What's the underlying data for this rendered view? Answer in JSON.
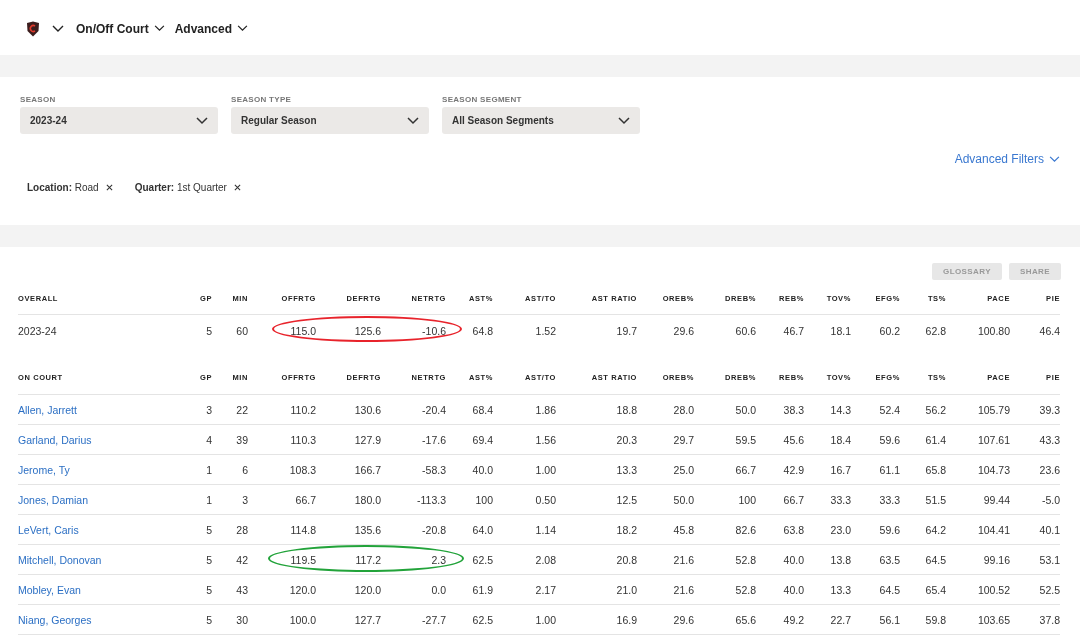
{
  "nav": {
    "menus": [
      {
        "label": "On/Off Court"
      },
      {
        "label": "Advanced"
      }
    ]
  },
  "filters": {
    "selects": [
      {
        "label": "SEASON",
        "value": "2023-24"
      },
      {
        "label": "SEASON TYPE",
        "value": "Regular Season"
      },
      {
        "label": "SEASON SEGMENT",
        "value": "All Season Segments"
      }
    ],
    "advanced_filters": "Advanced Filters",
    "chips": [
      {
        "name": "Location:",
        "value": "Road"
      },
      {
        "name": "Quarter:",
        "value": "1st Quarter"
      }
    ]
  },
  "toolbar": {
    "buttons": [
      "GLOSSARY",
      "SHARE"
    ]
  },
  "overall": {
    "columns": [
      "OVERALL",
      "GP",
      "MIN",
      "OFFRTG",
      "DEFRTG",
      "NETRTG",
      "AST%",
      "AST/TO",
      "AST RATIO",
      "OREB%",
      "DREB%",
      "REB%",
      "TOV%",
      "EFG%",
      "TS%",
      "PACE",
      "PIE"
    ],
    "row": {
      "cells": [
        "2023-24",
        "5",
        "60",
        "115.0",
        "125.6",
        "-10.6",
        "64.8",
        "1.52",
        "19.7",
        "29.6",
        "60.6",
        "46.7",
        "18.1",
        "60.2",
        "62.8",
        "100.80",
        "46.4"
      ],
      "circled": true
    }
  },
  "on_court": {
    "columns": [
      "ON COURT",
      "GP",
      "MIN",
      "OFFRTG",
      "DEFRTG",
      "NETRTG",
      "AST%",
      "AST/TO",
      "AST RATIO",
      "OREB%",
      "DREB%",
      "REB%",
      "TOV%",
      "EFG%",
      "TS%",
      "PACE",
      "PIE"
    ],
    "rows": [
      {
        "cells": [
          "Allen, Jarrett",
          "3",
          "22",
          "110.2",
          "130.6",
          "-20.4",
          "68.4",
          "1.86",
          "18.8",
          "28.0",
          "50.0",
          "38.3",
          "14.3",
          "52.4",
          "56.2",
          "105.79",
          "39.3"
        ],
        "circled": false
      },
      {
        "cells": [
          "Garland, Darius",
          "4",
          "39",
          "110.3",
          "127.9",
          "-17.6",
          "69.4",
          "1.56",
          "20.3",
          "29.7",
          "59.5",
          "45.6",
          "18.4",
          "59.6",
          "61.4",
          "107.61",
          "43.3"
        ],
        "circled": false
      },
      {
        "cells": [
          "Jerome, Ty",
          "1",
          "6",
          "108.3",
          "166.7",
          "-58.3",
          "40.0",
          "1.00",
          "13.3",
          "25.0",
          "66.7",
          "42.9",
          "16.7",
          "61.1",
          "65.8",
          "104.73",
          "23.6"
        ],
        "circled": false
      },
      {
        "cells": [
          "Jones, Damian",
          "1",
          "3",
          "66.7",
          "180.0",
          "-113.3",
          "100",
          "0.50",
          "12.5",
          "50.0",
          "100",
          "66.7",
          "33.3",
          "33.3",
          "51.5",
          "99.44",
          "-5.0"
        ],
        "circled": false
      },
      {
        "cells": [
          "LeVert, Caris",
          "5",
          "28",
          "114.8",
          "135.6",
          "-20.8",
          "64.0",
          "1.14",
          "18.2",
          "45.8",
          "82.6",
          "63.8",
          "23.0",
          "59.6",
          "64.2",
          "104.41",
          "40.1"
        ],
        "circled": false
      },
      {
        "cells": [
          "Mitchell, Donovan",
          "5",
          "42",
          "119.5",
          "117.2",
          "2.3",
          "62.5",
          "2.08",
          "20.8",
          "21.6",
          "52.8",
          "40.0",
          "13.8",
          "63.5",
          "64.5",
          "99.16",
          "53.1"
        ],
        "circled": true
      },
      {
        "cells": [
          "Mobley, Evan",
          "5",
          "43",
          "120.0",
          "120.0",
          "0.0",
          "61.9",
          "2.17",
          "21.0",
          "21.6",
          "52.8",
          "40.0",
          "13.3",
          "64.5",
          "65.4",
          "100.52",
          "52.5"
        ],
        "circled": false
      },
      {
        "cells": [
          "Niang, Georges",
          "5",
          "30",
          "100.0",
          "127.7",
          "-27.7",
          "62.5",
          "1.00",
          "16.9",
          "29.6",
          "65.6",
          "49.2",
          "22.7",
          "56.1",
          "59.8",
          "103.65",
          "37.8"
        ],
        "circled": false
      }
    ]
  }
}
